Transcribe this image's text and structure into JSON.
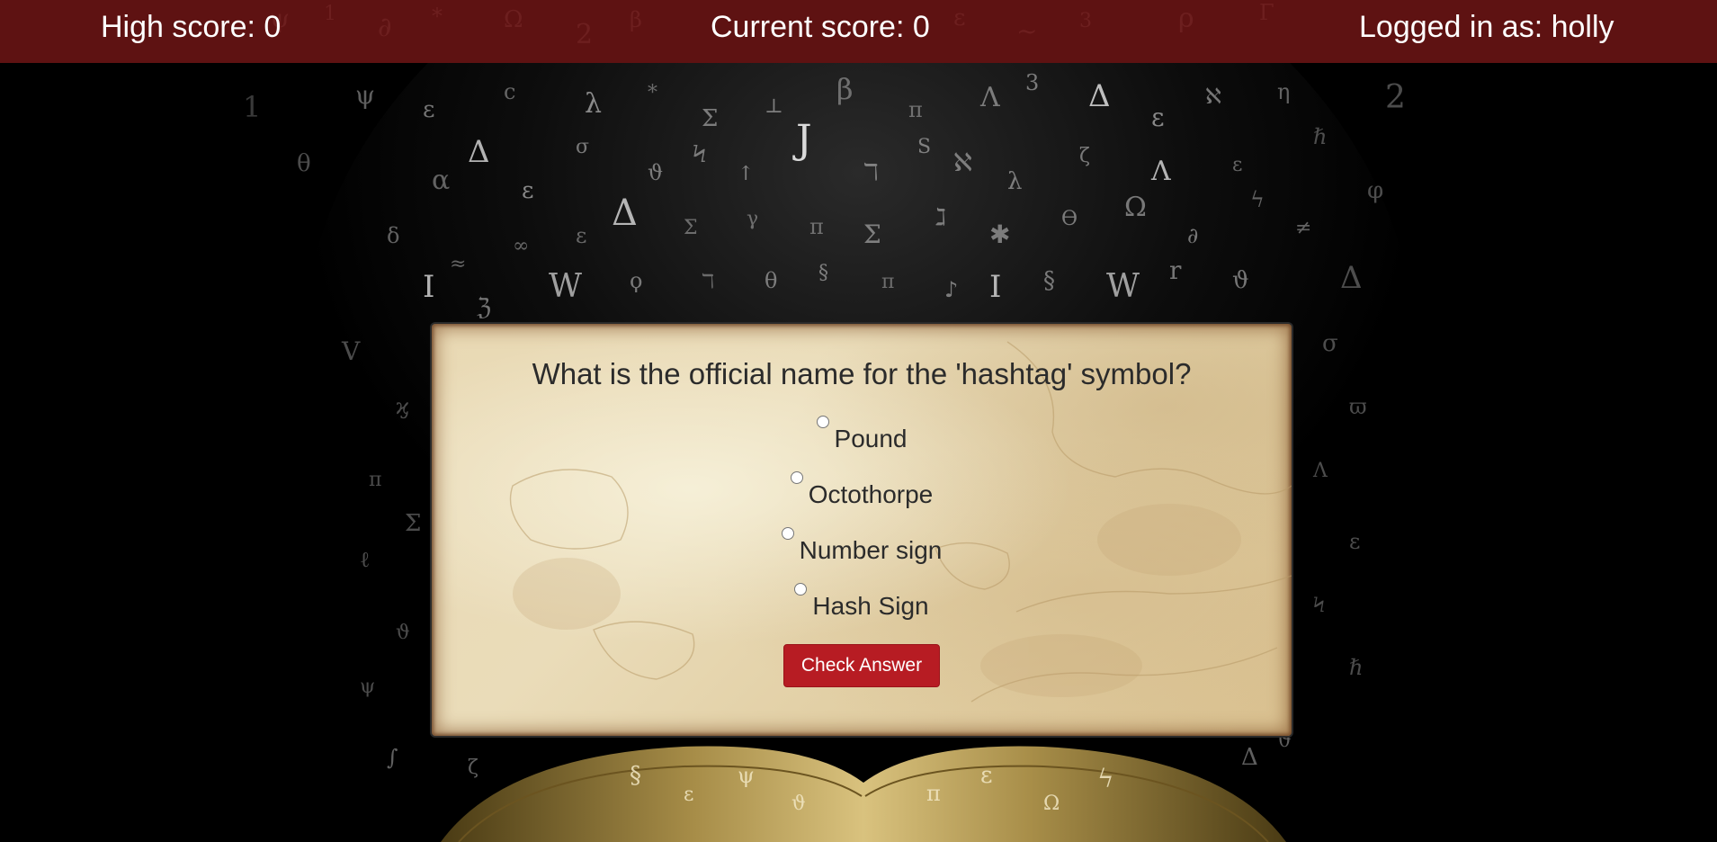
{
  "header": {
    "high_score": "High score: 0",
    "current_score": "Current score: 0",
    "logged_in": "Logged in as: holly"
  },
  "quiz": {
    "question": "What is the official name for the 'hashtag' symbol?",
    "answers": [
      {
        "label": "Pound"
      },
      {
        "label": "Octothorpe"
      },
      {
        "label": "Number sign"
      },
      {
        "label": "Hash Sign"
      }
    ],
    "check_button_label": "Check Answer"
  },
  "colors": {
    "header_bg": "#5e1212",
    "button_bg": "#b71c23",
    "page_bg": "#000000",
    "parchment": "#e6d4ac"
  }
}
